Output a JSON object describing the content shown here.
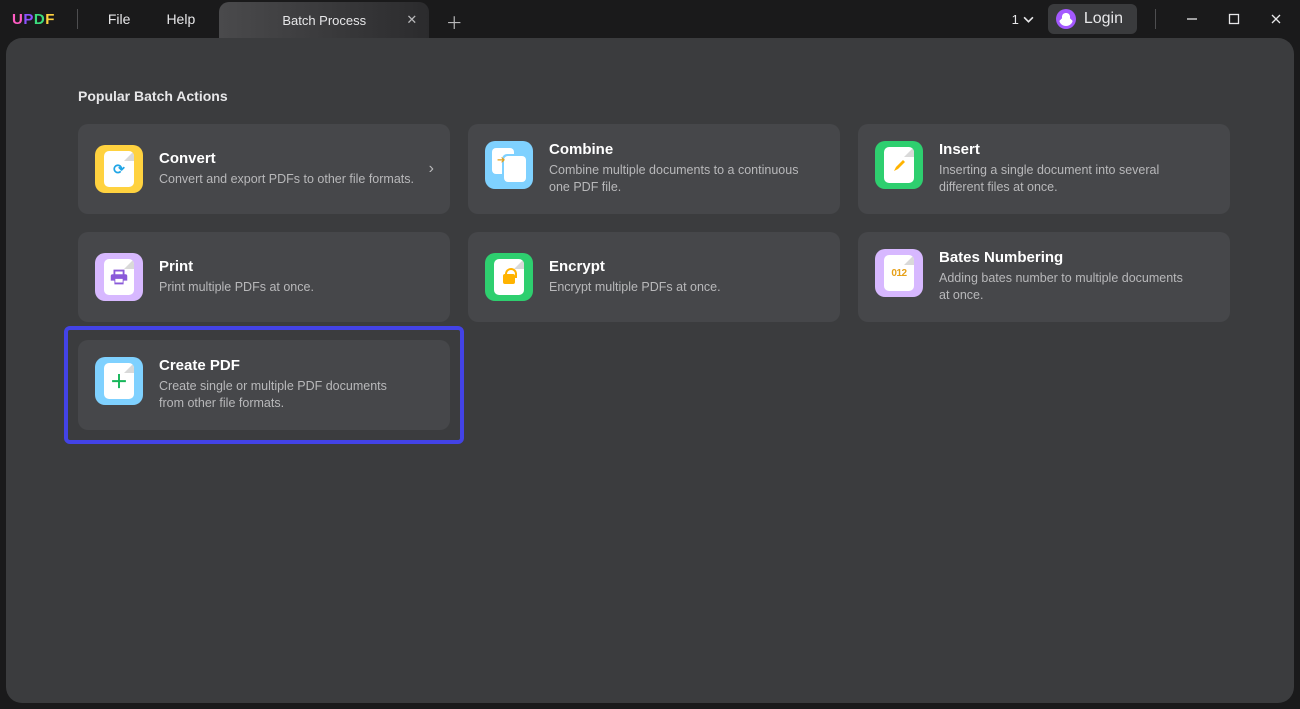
{
  "app": {
    "logo_letters": [
      "U",
      "P",
      "D",
      "F"
    ]
  },
  "menu": {
    "file": "File",
    "help": "Help"
  },
  "tab": {
    "title": "Batch Process"
  },
  "header": {
    "doc_count": "1",
    "login": "Login"
  },
  "section": {
    "title": "Popular Batch Actions"
  },
  "cards": {
    "convert": {
      "title": "Convert",
      "desc": "Convert and export PDFs to other file formats."
    },
    "combine": {
      "title": "Combine",
      "desc": "Combine multiple documents to a continuous one PDF file."
    },
    "insert": {
      "title": "Insert",
      "desc": "Inserting a single document into several different files at once."
    },
    "print": {
      "title": "Print",
      "desc": "Print multiple PDFs at once."
    },
    "encrypt": {
      "title": "Encrypt",
      "desc": "Encrypt multiple PDFs at once."
    },
    "bates": {
      "title": "Bates Numbering",
      "desc": "Adding bates number to multiple documents at once."
    },
    "create": {
      "title": "Create PDF",
      "desc": "Create single or multiple PDF documents from other file formats."
    }
  }
}
